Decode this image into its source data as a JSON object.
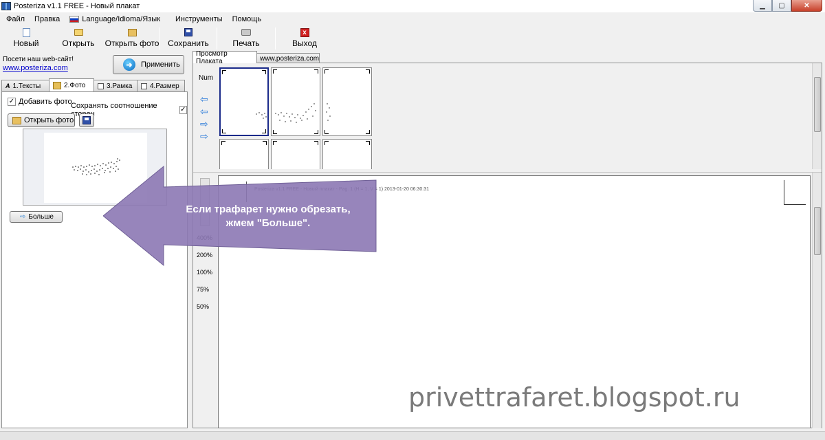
{
  "window": {
    "title": "Posteriza v1.1 FREE - Новый плакат",
    "controls": [
      "minimize",
      "maximize",
      "close"
    ]
  },
  "menu": {
    "items": [
      "Файл",
      "Правка",
      "Language/Idioma/Язык",
      "Инструменты",
      "Помощь"
    ]
  },
  "toolbar": {
    "new_label": "Новый",
    "open_label": "Открыть",
    "open_photo_label": "Открыть фото",
    "save_label": "Сохранить",
    "print_label": "Печать",
    "exit_label": "Выход"
  },
  "left": {
    "visit_text": "Посети наш web-сайт!",
    "site_link": "www.posteriza.com",
    "apply_label": "Применить",
    "tabs": [
      "1.Тексты",
      "2.Фото",
      "3.Рамка",
      "4.Размер"
    ],
    "active_tab": "2.Фото",
    "add_photo_label": "Добавить фото",
    "add_photo_checked": true,
    "keep_ratio_label": "Сохранять соотношение сторон",
    "keep_ratio_checked": true,
    "open_photo_button": "Открыть фото",
    "more_button": "Больше"
  },
  "right": {
    "tabs": [
      "Просмотр Плаката",
      "www.posteriza.com"
    ],
    "active_tab": "Просмотр Плаката",
    "num_label": "Num",
    "zoom_levels": [
      "400%",
      "200%",
      "100%",
      "75%",
      "50%"
    ],
    "page_header": "Posteriza v1.1 FREE - Новый плакат - Pag. 1 (H = 1, V = 1) 2013-01-20  06:30:31"
  },
  "callout": {
    "line1": "Если трафарет нужно обрезать,",
    "line2": "жмем \"Больше\".",
    "color": "#8c78b4"
  },
  "watermark": "privettrafaret.blogspot.ru"
}
